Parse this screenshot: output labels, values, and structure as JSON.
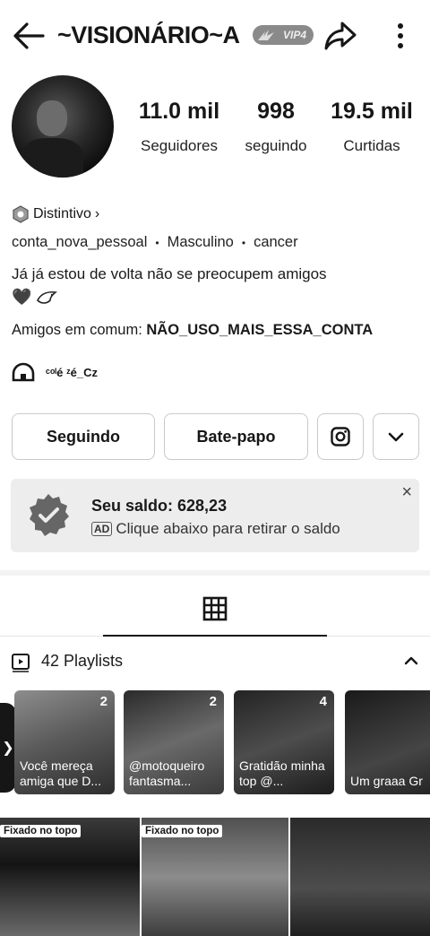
{
  "header": {
    "username": "~VISIONÁRIO~A",
    "vip_badge": "VIP4"
  },
  "stats": [
    {
      "value": "11.0 mil",
      "label": "Seguidores"
    },
    {
      "value": "998",
      "label": "seguindo"
    },
    {
      "value": "19.5 mil",
      "label": "Curtidas"
    }
  ],
  "profile": {
    "badge_label": "Distintivo",
    "badge_chevron": "›",
    "account_name": "conta_nova_pessoal",
    "gender": "Masculino",
    "sign": "cancer",
    "bio": "Já já estou de volta não se preocupem amigos",
    "bio_emoji": "🖤",
    "common_label": "Amigos em comum:",
    "common_friend": "NÃO_USO_MAIS_ESSA_CONTA",
    "link_text": "ᶜᵒˡé ᶻé_Cz"
  },
  "actions": {
    "following": "Seguindo",
    "chat": "Bate-papo"
  },
  "ad": {
    "title": "Seu saldo: 628,23",
    "tag": "AD",
    "subtitle": "Clique abaixo para retirar o saldo",
    "close": "×"
  },
  "playlists": {
    "label": "42 Playlists",
    "items": [
      {
        "count": "2",
        "title": "Você mereça amiga que D..."
      },
      {
        "count": "2",
        "title": "@motoqueiro fantasma..."
      },
      {
        "count": "4",
        "title": "Gratidão minha top @..."
      },
      {
        "count": "",
        "title": "Um graaa Gr"
      }
    ]
  },
  "videos": [
    {
      "pin": "Fixado no topo"
    },
    {
      "pin": "Fixado no topo"
    },
    {
      "pin": ""
    }
  ],
  "side_tab_glyph": "❯"
}
